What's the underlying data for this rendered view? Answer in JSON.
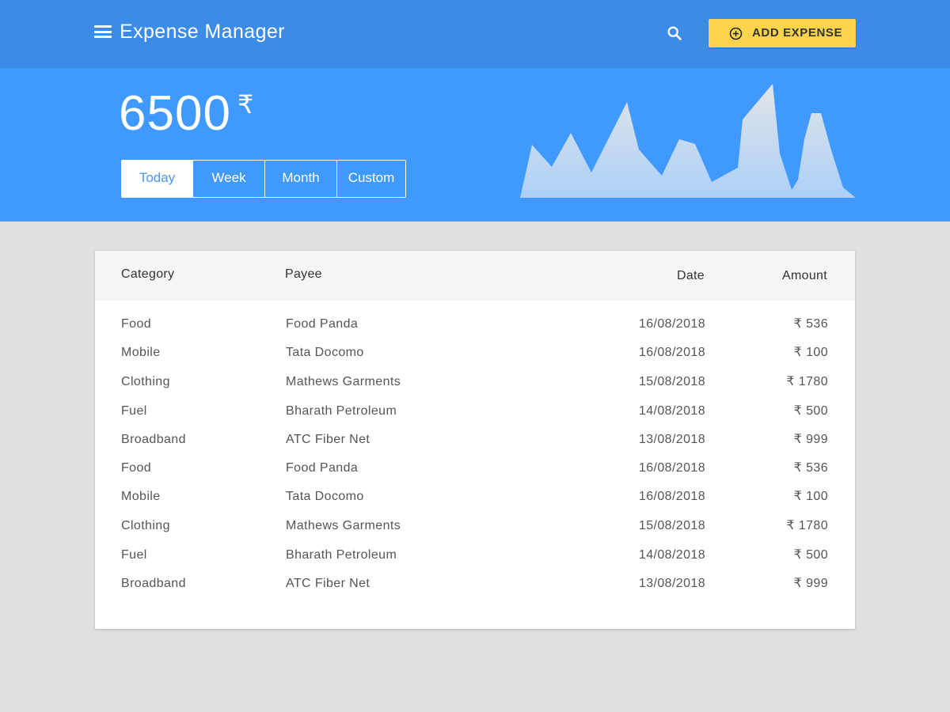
{
  "header": {
    "title": "Expense Manager",
    "add_button_label": "ADD EXPENSE",
    "icons": [
      "menu-icon",
      "search-icon",
      "add-circle-icon"
    ],
    "colors": {
      "appbar": "#3c8ce7",
      "hero": "#3f99fe",
      "accent": "#fcd34d"
    }
  },
  "summary": {
    "total": "6500",
    "currency": "₹",
    "range_tabs": [
      {
        "label": "Today",
        "active": true
      },
      {
        "label": "Week",
        "active": false
      },
      {
        "label": "Month",
        "active": false
      },
      {
        "label": "Custom",
        "active": false
      }
    ]
  },
  "table": {
    "headers": {
      "category": "Category",
      "payee": "Payee",
      "date": "Date",
      "amount": "Amount"
    },
    "rows": [
      {
        "category": "Food",
        "payee": "Food Panda",
        "date": "16/08/2018",
        "amount": "₹ 536"
      },
      {
        "category": "Mobile",
        "payee": "Tata Docomo",
        "date": "16/08/2018",
        "amount": "₹ 100"
      },
      {
        "category": "Clothing",
        "payee": "Mathews Garments",
        "date": "15/08/2018",
        "amount": "₹ 1780"
      },
      {
        "category": "Fuel",
        "payee": "Bharath Petroleum",
        "date": "14/08/2018",
        "amount": "₹ 500"
      },
      {
        "category": "Broadband",
        "payee": "ATC Fiber Net",
        "date": "13/08/2018",
        "amount": "₹ 999"
      },
      {
        "category": "Food",
        "payee": "Food Panda",
        "date": "16/08/2018",
        "amount": "₹ 536"
      },
      {
        "category": "Mobile",
        "payee": "Tata Docomo",
        "date": "16/08/2018",
        "amount": "₹ 100"
      },
      {
        "category": "Clothing",
        "payee": "Mathews Garments",
        "date": "15/08/2018",
        "amount": "₹ 1780"
      },
      {
        "category": "Fuel",
        "payee": "Bharath Petroleum",
        "date": "14/08/2018",
        "amount": "₹ 500"
      },
      {
        "category": "Broadband",
        "payee": "ATC Fiber Net",
        "date": "13/08/2018",
        "amount": "₹ 999"
      }
    ]
  }
}
